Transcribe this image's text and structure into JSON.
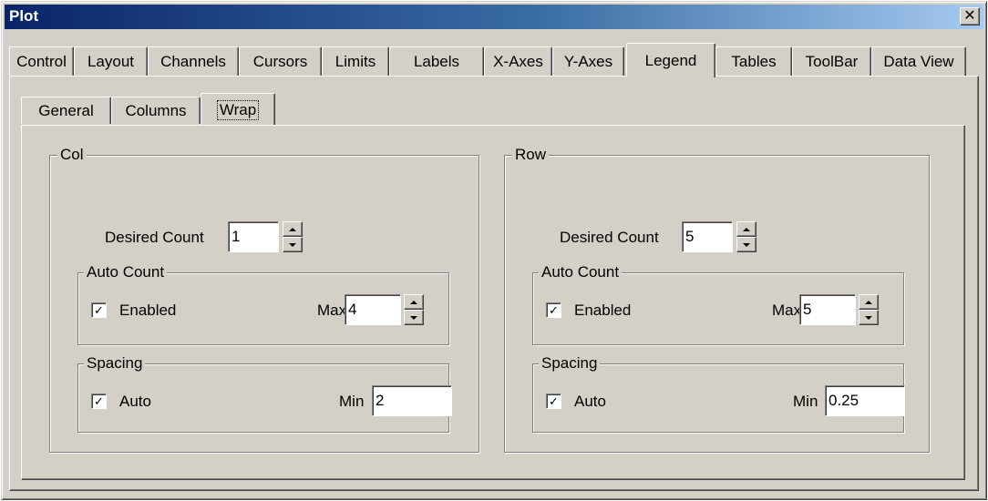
{
  "window": {
    "title": "Plot",
    "close_glyph": "✕"
  },
  "tabs": [
    {
      "label": "Control"
    },
    {
      "label": "Layout"
    },
    {
      "label": "Channels"
    },
    {
      "label": "Cursors"
    },
    {
      "label": "Limits"
    },
    {
      "label": "Labels"
    },
    {
      "label": "X-Axes"
    },
    {
      "label": "Y-Axes"
    },
    {
      "label": "Legend",
      "active": true
    },
    {
      "label": "Tables"
    },
    {
      "label": "ToolBar"
    },
    {
      "label": "Data View"
    }
  ],
  "subtabs": [
    {
      "label": "General"
    },
    {
      "label": "Columns"
    },
    {
      "label": "Wrap",
      "active": true
    }
  ],
  "col": {
    "title": "Col",
    "desired_count_label": "Desired Count",
    "desired_count_value": "1",
    "auto_count": {
      "title": "Auto Count",
      "enabled_label": "Enabled",
      "enabled_checked": true,
      "max_label": "Max",
      "max_value": "4"
    },
    "spacing": {
      "title": "Spacing",
      "auto_label": "Auto",
      "auto_checked": true,
      "min_label": "Min",
      "min_value": "2"
    }
  },
  "row": {
    "title": "Row",
    "desired_count_label": "Desired Count",
    "desired_count_value": "5",
    "auto_count": {
      "title": "Auto Count",
      "enabled_label": "Enabled",
      "enabled_checked": true,
      "max_label": "Max",
      "max_value": "5"
    },
    "spacing": {
      "title": "Spacing",
      "auto_label": "Auto",
      "auto_checked": true,
      "min_label": "Min",
      "min_value": "0.25"
    }
  },
  "icons": {
    "check": "✓",
    "close": "close-icon",
    "spin_up": "arrow-up-icon",
    "spin_down": "arrow-down-icon"
  },
  "colors": {
    "titlebar_start": "#0a246a",
    "titlebar_end": "#a6caf0",
    "face": "#d4d0c8"
  }
}
